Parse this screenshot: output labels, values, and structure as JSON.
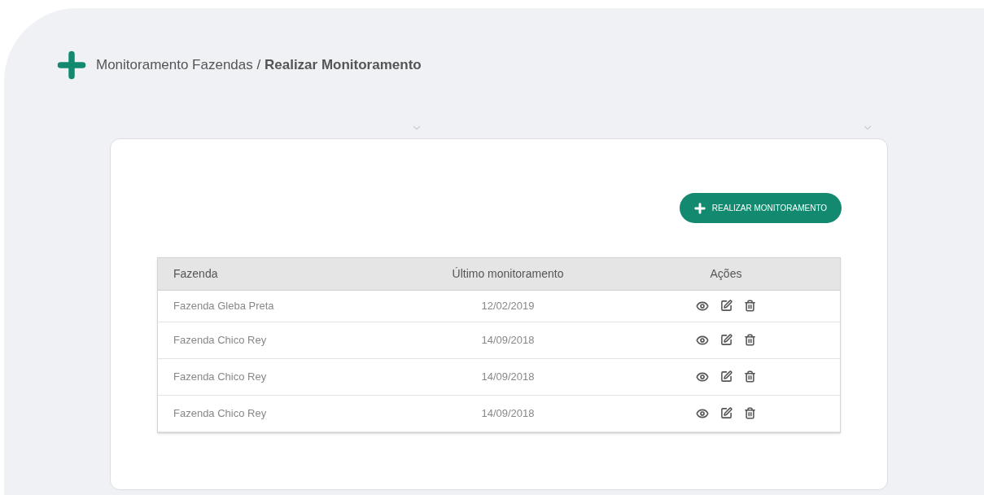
{
  "breadcrumb": {
    "parent": "Monitoramento Fazendas",
    "separator": "/",
    "current": "Realizar Monitoramento"
  },
  "action_button": {
    "label": "REALIZAR MONITORAMENTO"
  },
  "table": {
    "columns": [
      "Fazenda",
      "Último monitoramento",
      "Ações"
    ],
    "rows": [
      {
        "farm": "Fazenda Gleba Preta",
        "date": "12/02/2019"
      },
      {
        "farm": "Fazenda Chico Rey",
        "date": "14/09/2018"
      },
      {
        "farm": "Fazenda Chico Rey",
        "date": "14/09/2018"
      },
      {
        "farm": "Fazenda Chico Rey",
        "date": "14/09/2018"
      }
    ]
  }
}
